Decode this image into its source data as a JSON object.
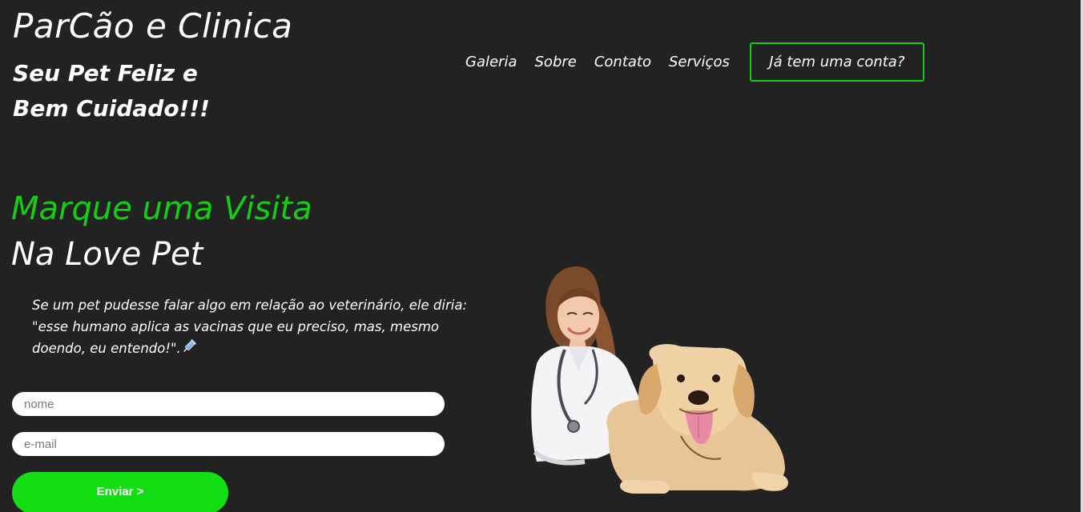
{
  "header": {
    "brand_title": "ParCão e Clinica",
    "tagline": "Seu Pet Feliz e Bem Cuidado!!!"
  },
  "nav": {
    "links": [
      {
        "label": "Galeria"
      },
      {
        "label": "Sobre"
      },
      {
        "label": "Contato"
      },
      {
        "label": "Serviços"
      }
    ],
    "login_button": "Já tem uma conta?"
  },
  "hero": {
    "heading_accent": "Marque uma Visita",
    "heading_main": "Na Love Pet",
    "quote": "Se um pet pudesse falar algo em relação ao veterinário, ele diria: \"esse humano aplica as vacinas que eu preciso, mas, mesmo doendo, eu entendo!\".",
    "quote_icon": "syringe-icon"
  },
  "form": {
    "name_placeholder": "nome",
    "email_placeholder": "e-mail",
    "submit_label": "Enviar >"
  },
  "colors": {
    "background": "#222222",
    "accent": "#13cf13",
    "submit": "#13dd13",
    "text": "#ffffff"
  }
}
